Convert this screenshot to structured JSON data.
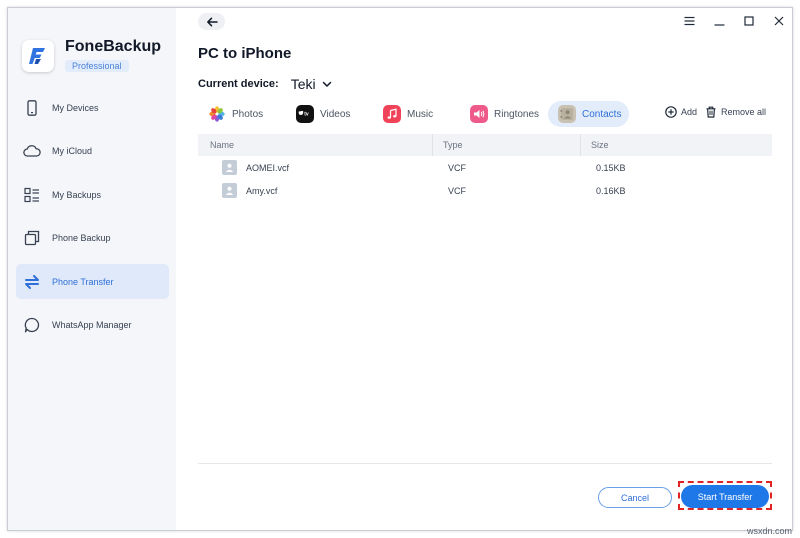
{
  "app": {
    "name": "FoneBackup",
    "edition": "Professional"
  },
  "sidebar": {
    "items": [
      {
        "label": "My Devices",
        "icon": "phone-icon",
        "active": false
      },
      {
        "label": "My iCloud",
        "icon": "cloud-icon",
        "active": false
      },
      {
        "label": "My Backups",
        "icon": "backups-icon",
        "active": false
      },
      {
        "label": "Phone Backup",
        "icon": "copy-icon",
        "active": false
      },
      {
        "label": "Phone Transfer",
        "icon": "transfer-icon",
        "active": true
      },
      {
        "label": "WhatsApp Manager",
        "icon": "chat-icon",
        "active": false
      }
    ]
  },
  "main": {
    "title": "PC to iPhone",
    "device_label": "Current device:",
    "device_name": "Teki",
    "tabs": [
      {
        "label": "Photos",
        "icon": "photos-icon",
        "active": false
      },
      {
        "label": "Videos",
        "icon": "appletv-icon",
        "active": false
      },
      {
        "label": "Music",
        "icon": "music-icon",
        "active": false
      },
      {
        "label": "Ringtones",
        "icon": "ringtone-icon",
        "active": false
      },
      {
        "label": "Contacts",
        "icon": "contacts-icon",
        "active": true
      }
    ],
    "toolbar": {
      "add_label": "Add",
      "remove_all_label": "Remove all"
    },
    "table": {
      "columns": [
        "Name",
        "Type",
        "Size"
      ],
      "rows": [
        {
          "name": "AOMEI.vcf",
          "type": "VCF",
          "size": "0.15KB"
        },
        {
          "name": "Amy.vcf",
          "type": "VCF",
          "size": "0.16KB"
        }
      ]
    },
    "footer": {
      "cancel_label": "Cancel",
      "start_label": "Start Transfer"
    }
  },
  "colors": {
    "accent": "#1f78e8",
    "active_nav_bg": "#dfe9f9",
    "highlight": "#e02424"
  },
  "watermark": "wsxdn.com"
}
